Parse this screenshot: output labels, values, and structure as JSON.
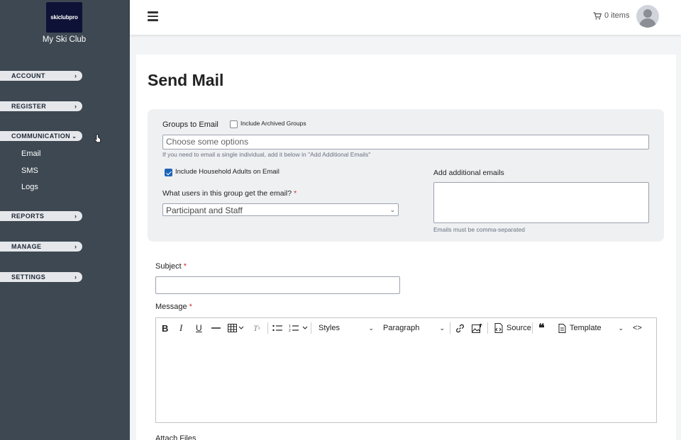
{
  "sidebar": {
    "logo_text": "skiclubpro",
    "club_name": "My Ski Club",
    "nav": [
      {
        "label": "ACCOUNT"
      },
      {
        "label": "REGISTER"
      },
      {
        "label": "COMMUNICATION"
      },
      {
        "label": "REPORTS"
      },
      {
        "label": "MANAGE"
      },
      {
        "label": "SETTINGS"
      }
    ],
    "communication_items": [
      "Email",
      "SMS",
      "Logs"
    ]
  },
  "topbar": {
    "cart_label": "0 items",
    "icons": [
      "hamburger-menu-icon",
      "cart-icon",
      "user-avatar-icon"
    ]
  },
  "page": {
    "title": "Send Mail"
  },
  "groups": {
    "label": "Groups to Email",
    "include_archived_label": "Include Archived Groups",
    "include_archived_checked": false,
    "placeholder": "Choose some options",
    "hint": "If you need to email a single individual, add it below in \"Add Additional Emails\"",
    "include_household_label": "Include Household Adults on Email",
    "include_household_checked": true,
    "users_label": "What users in this group get the email?",
    "users_selected": "Participant and Staff",
    "additional_label": "Add additional emails",
    "additional_value": "",
    "additional_hint": "Emails must be comma-separated"
  },
  "form": {
    "subject_label": "Subject",
    "subject_value": "",
    "message_label": "Message",
    "attach_label": "Attach Files"
  },
  "editor": {
    "styles_label": "Styles",
    "paragraph_label": "Paragraph",
    "source_label": "Source",
    "template_label": "Template",
    "content": ""
  },
  "colors": {
    "sidebar_bg": "#3d4852",
    "checkbox_on": "#1d63b8",
    "required": "#d32f2f"
  }
}
